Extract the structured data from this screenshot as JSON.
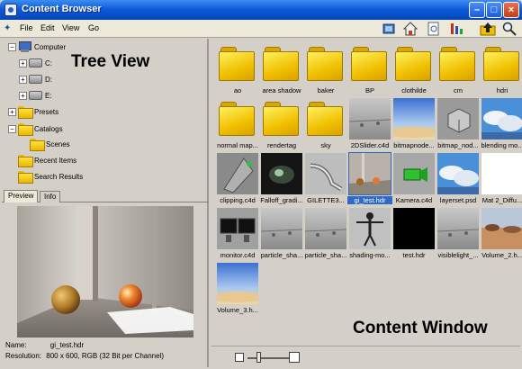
{
  "window": {
    "title": "Content Browser"
  },
  "menu": [
    "File",
    "Edit",
    "View",
    "Go"
  ],
  "toolbar_icons": [
    "view-mode-icon",
    "home-icon",
    "search-file-icon",
    "sort-icon",
    "up-folder-icon",
    "magnifier-icon"
  ],
  "tree": {
    "items": [
      {
        "label": "Computer",
        "icon": "computer-icon"
      },
      {
        "label": "C:",
        "icon": "drive-icon"
      },
      {
        "label": "D:",
        "icon": "drive-icon"
      },
      {
        "label": "E:",
        "icon": "drive-icon"
      },
      {
        "label": "Presets",
        "icon": "folder-icon"
      },
      {
        "label": "Catalogs",
        "icon": "folder-icon"
      },
      {
        "label": "Scenes",
        "icon": "folder-icon"
      },
      {
        "label": "Recent Items",
        "icon": "folder-icon"
      },
      {
        "label": "Search Results",
        "icon": "folder-icon"
      }
    ],
    "overlay_label": "Tree View"
  },
  "tabs": [
    "Preview",
    "Info"
  ],
  "preview_info": {
    "name_label": "Name:",
    "name_value": "gi_test.hdr",
    "res_label": "Resolution:",
    "res_value": "800 x 600, RGB (32 Bit per Channel)"
  },
  "content": {
    "overlay_label": "Content Window",
    "items": [
      {
        "name": "ao",
        "kind": "folder"
      },
      {
        "name": "area shadow",
        "kind": "folder"
      },
      {
        "name": "baker",
        "kind": "folder"
      },
      {
        "name": "BP",
        "kind": "folder"
      },
      {
        "name": "clothilde",
        "kind": "folder"
      },
      {
        "name": "cm",
        "kind": "folder"
      },
      {
        "name": "hdri",
        "kind": "folder"
      },
      {
        "name": "normal map...",
        "kind": "folder"
      },
      {
        "name": "rendertag",
        "kind": "folder"
      },
      {
        "name": "sky",
        "kind": "folder"
      },
      {
        "name": "2DSlider.c4d",
        "kind": "grey"
      },
      {
        "name": "bitmapnode...",
        "kind": "sky"
      },
      {
        "name": "bitmap_nod...",
        "kind": "cube"
      },
      {
        "name": "blending mo...",
        "kind": "clouds"
      },
      {
        "name": "clipping.c4d",
        "kind": "clip"
      },
      {
        "name": "Falloff_gradi...",
        "kind": "dark"
      },
      {
        "name": "GILETTE3...",
        "kind": "tube"
      },
      {
        "name": "gi_test.hdr",
        "kind": "room",
        "selected": true
      },
      {
        "name": "Kamera.c4d",
        "kind": "green"
      },
      {
        "name": "layerset.psd",
        "kind": "clouds"
      },
      {
        "name": "Mat 2_Diffu...",
        "kind": "white"
      },
      {
        "name": "monitor.c4d",
        "kind": "monitor"
      },
      {
        "name": "particle_sha...",
        "kind": "grey"
      },
      {
        "name": "particle_sha...",
        "kind": "grey"
      },
      {
        "name": "shading-mo...",
        "kind": "figure"
      },
      {
        "name": "test.hdr",
        "kind": "crescent"
      },
      {
        "name": "visiblelight_...",
        "kind": "grey"
      },
      {
        "name": "Volume_2.h...",
        "kind": "landscape"
      },
      {
        "name": "Volume_3.h...",
        "kind": "sky"
      }
    ]
  }
}
